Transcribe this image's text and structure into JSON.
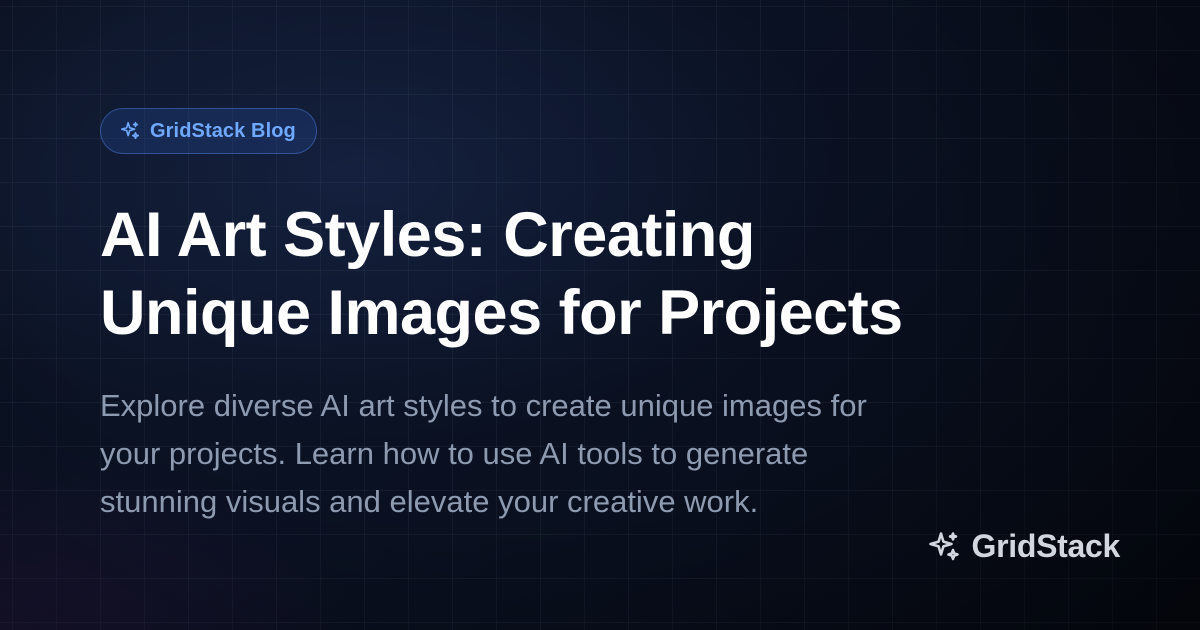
{
  "badge": {
    "icon": "sparkles-icon",
    "label": "GridStack Blog",
    "color": "#6ea8ff"
  },
  "title": {
    "lines": [
      "AI Art Styles: Creating",
      "Unique Images for Projects"
    ]
  },
  "description": {
    "lines": [
      "Explore diverse AI art styles to create unique images for",
      "your projects. Learn how to use AI tools to generate",
      "stunning visuals and elevate your creative work."
    ]
  },
  "brand": {
    "icon": "sparkles-icon",
    "name": "GridStack"
  },
  "colors": {
    "background": "#0b1120",
    "title": "#ffffff",
    "description": "#8e9ab0",
    "brand": "#d2d7df",
    "accent": "#6ea8ff"
  }
}
